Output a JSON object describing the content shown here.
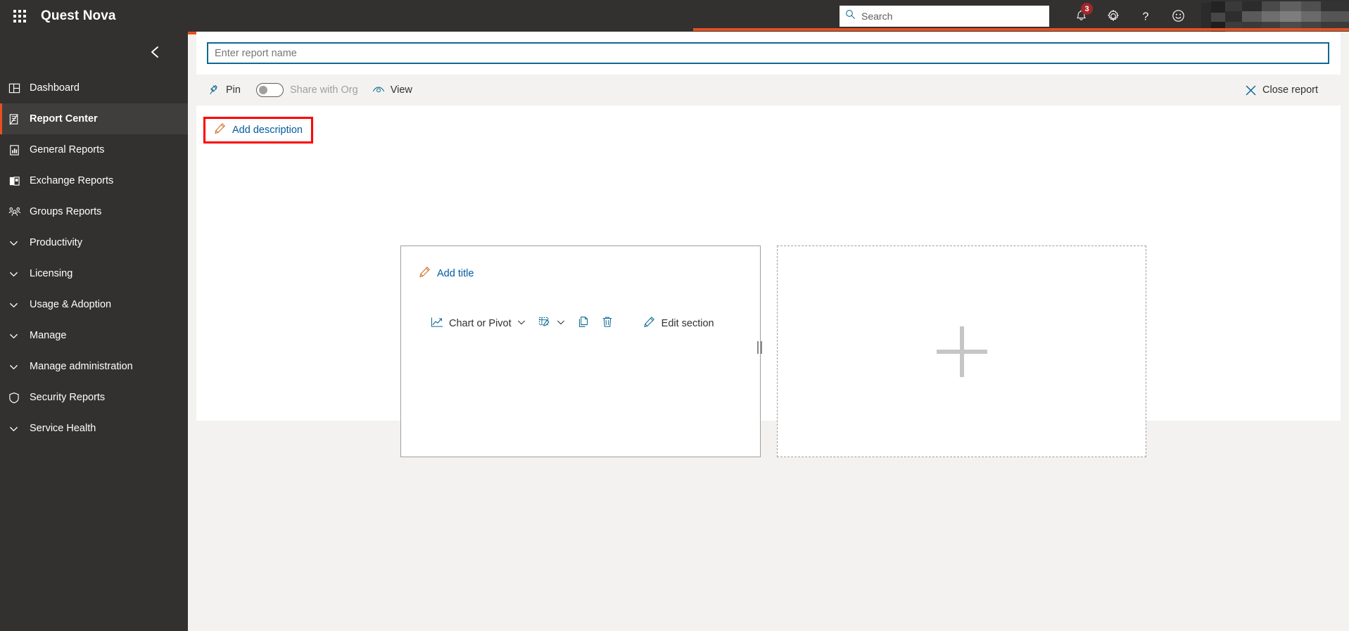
{
  "header": {
    "waffle_icon": "app-launcher-icon",
    "brand": "Quest Nova",
    "search": {
      "placeholder": "Search",
      "icon": "search-icon"
    },
    "notifications": {
      "icon": "bell-icon",
      "badge": "3"
    },
    "settings": {
      "icon": "gear-icon"
    },
    "help": {
      "icon": "question-mark-icon"
    },
    "feedback": {
      "icon": "smiley-face-icon"
    },
    "user": {
      "label": "",
      "icon": "avatar-icon"
    },
    "accent_color": "#e8501e",
    "background_color": "#323130"
  },
  "sidebar": {
    "collapse_icon": "chevron-left-icon",
    "items": [
      {
        "label": "Dashboard",
        "icon": "dashboard-icon",
        "active": false,
        "expandable": false
      },
      {
        "label": "Report Center",
        "icon": "report-center-icon",
        "active": true,
        "expandable": false
      },
      {
        "label": "General Reports",
        "icon": "general-reports-icon",
        "active": false,
        "expandable": false
      },
      {
        "label": "Exchange Reports",
        "icon": "exchange-reports-icon",
        "active": false,
        "expandable": false
      },
      {
        "label": "Groups Reports",
        "icon": "groups-reports-icon",
        "active": false,
        "expandable": false
      },
      {
        "label": "Productivity",
        "icon": "chevron-down-icon",
        "active": false,
        "expandable": true
      },
      {
        "label": "Licensing",
        "icon": "chevron-down-icon",
        "active": false,
        "expandable": true
      },
      {
        "label": "Usage & Adoption",
        "icon": "chevron-down-icon",
        "active": false,
        "expandable": true
      },
      {
        "label": "Manage",
        "icon": "chevron-down-icon",
        "active": false,
        "expandable": true
      },
      {
        "label": "Manage administration",
        "icon": "chevron-down-icon",
        "active": false,
        "expandable": true
      },
      {
        "label": "Security Reports",
        "icon": "shield-icon",
        "active": false,
        "expandable": false
      },
      {
        "label": "Service Health",
        "icon": "chevron-down-icon",
        "active": false,
        "expandable": true
      }
    ]
  },
  "report": {
    "name_value": "",
    "name_placeholder": "Enter report name",
    "toolbar": {
      "pin_label": "Pin",
      "pin_icon": "pin-icon",
      "share_label": "Share with Org",
      "share_enabled": false,
      "view_label": "View",
      "view_icon": "eye-icon",
      "close_label": "Close report",
      "close_icon": "close-x-icon"
    },
    "add_description_label": "Add description",
    "add_description_icon": "pencil-icon",
    "add_description_highlight_color": "#ff0000",
    "section": {
      "add_title_label": "Add title",
      "add_title_icon": "pencil-icon",
      "chart_or_pivot_label": "Chart or Pivot",
      "chart_or_pivot_icon": "line-chart-icon",
      "chart_dropdown_icon": "chevron-down-icon",
      "edit_table_icon": "edit-table-icon",
      "edit_table_dropdown_icon": "chevron-down-icon",
      "copy_icon": "copy-icon",
      "delete_icon": "trash-icon",
      "edit_section_label": "Edit section",
      "edit_section_icon": "pencil-icon",
      "resize_handle_icon": "resize-grip-icon"
    },
    "add_section_placeholder_icon": "plus-icon"
  },
  "colors": {
    "link_blue": "#005a9e",
    "input_focus_border": "#0a6a92",
    "accent_orange": "#e8501e",
    "page_background": "#f3f2f1",
    "badge_red": "#a4262c"
  }
}
